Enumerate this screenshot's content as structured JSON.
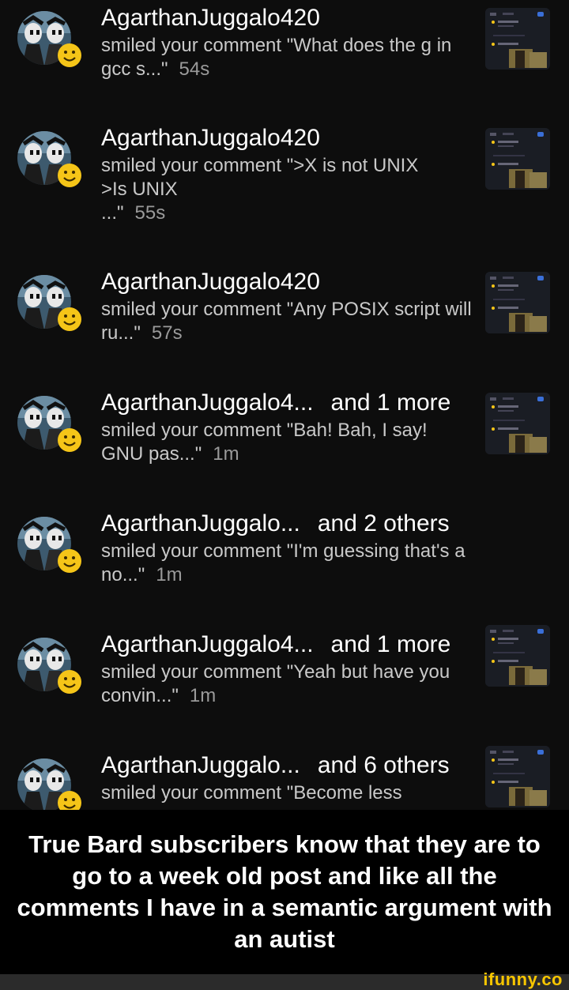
{
  "notifications": [
    {
      "user": "AgarthanJuggalo420",
      "others": "",
      "comment": "smiled your comment \"What does the g in gcc s...\"",
      "time": "54s"
    },
    {
      "user": "AgarthanJuggalo420",
      "others": "",
      "comment": "smiled your comment \">X is not UNIX\n>Is UNIX\n...\"",
      "time": "55s"
    },
    {
      "user": "AgarthanJuggalo420",
      "others": "",
      "comment": "smiled your comment \"Any POSIX script will ru...\"",
      "time": "57s"
    },
    {
      "user": "AgarthanJuggalo4...",
      "others": "and 1 more",
      "comment": "smiled your comment \"Bah! Bah, I say! GNU pas...\"",
      "time": "1m"
    },
    {
      "user": "AgarthanJuggalo...",
      "others": "and 2 others",
      "comment": "smiled your comment \"I'm guessing that's a no...\"",
      "time": "1m"
    },
    {
      "user": "AgarthanJuggalo4...",
      "others": "and 1 more",
      "comment": "smiled your comment \"Yeah but have you convin...\"",
      "time": "1m"
    },
    {
      "user": "AgarthanJuggalo...",
      "others": "and 6 others",
      "comment": "smiled your comment \"Become less",
      "time": ""
    }
  ],
  "caption": "True Bard subscribers know that they are to go to a week old post and like all the comments I have in a semantic argument with an autist",
  "brand": "ifunny.co",
  "colors": {
    "background": "#0d0d0d",
    "emoji": "#f5c518",
    "brand": "#f7c600"
  },
  "icons": {
    "avatar": "juggalo-avatar-icon",
    "emoji": "smiley-face-icon",
    "thumbnail": "post-thumbnail-icon"
  }
}
